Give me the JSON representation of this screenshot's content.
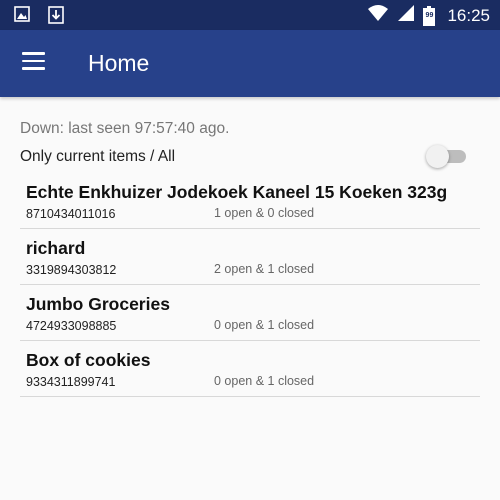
{
  "status_bar": {
    "time": "16:25",
    "battery_level": "99",
    "left_icons": [
      "image-icon",
      "download-icon"
    ],
    "right_icons": [
      "wifi-icon",
      "signal-icon",
      "battery-icon"
    ]
  },
  "app_bar": {
    "title": "Home",
    "background": "#27418a",
    "status_bar_background": "#1a2c61"
  },
  "main": {
    "status_text": "Down: last seen 97:57:40 ago.",
    "filter_label": "Only current items / All",
    "toggle_on": false
  },
  "items": [
    {
      "name": "Echte Enkhuizer Jodekoek Kaneel 15 Koeken 323g",
      "code": "8710434011016",
      "counts": "1 open & 0 closed"
    },
    {
      "name": "richard",
      "code": "3319894303812",
      "counts": "2 open & 1 closed"
    },
    {
      "name": "Jumbo Groceries",
      "code": "4724933098885",
      "counts": "0 open & 1 closed"
    },
    {
      "name": "Box of cookies",
      "code": "9334311899741",
      "counts": "0 open & 1 closed"
    }
  ]
}
